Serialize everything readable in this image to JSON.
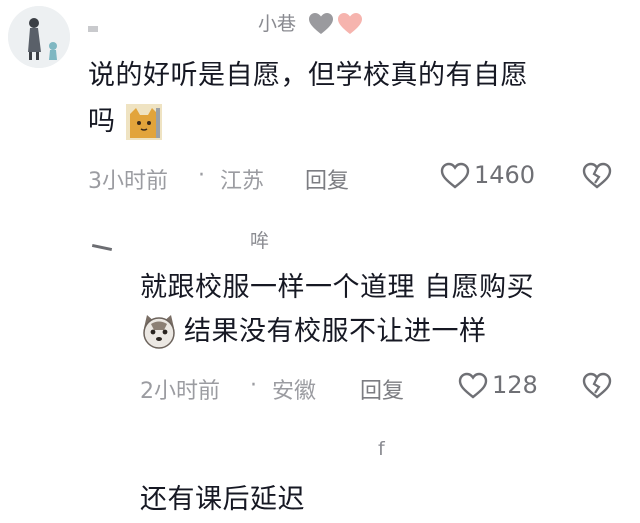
{
  "comments": [
    {
      "username": "小巷",
      "name_emojis": [
        "grey-heart",
        "pink-heart"
      ],
      "text_line1": "说的好听是自愿，但学校真的有自愿",
      "text_line2": "吗",
      "time": "3小时前",
      "location": "江苏",
      "reply_label": "回复",
      "likes": "1460"
    },
    {
      "username": "哞",
      "text_line1": "就跟校服一样一个道理 自愿购买",
      "text_line2": "结果没有校服不让进一样",
      "time": "2小时前",
      "location": "安徽",
      "reply_label": "回复",
      "likes": "128"
    },
    {
      "username": "f",
      "text_line1": "还有课后延迟"
    }
  ],
  "separator": "·"
}
